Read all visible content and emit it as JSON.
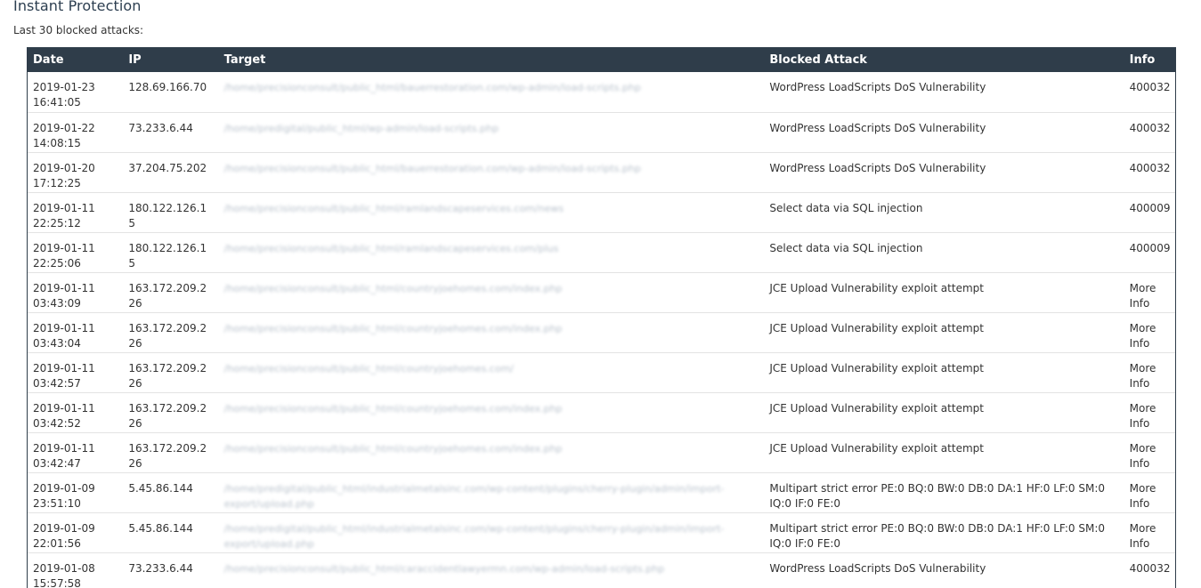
{
  "page": {
    "title": "Instant Protection",
    "subtitle": "Last 30 blocked attacks:"
  },
  "table": {
    "headers": {
      "date": "Date",
      "ip": "IP",
      "target": "Target",
      "attack": "Blocked Attack",
      "info": "Info"
    },
    "rows": [
      {
        "date": "2019-01-23",
        "time": "16:41:05",
        "ip": "128.69.166.70",
        "target": "/home/precisionconsult/public_html/bauerrestoration.com/wp-admin/load-scripts.php",
        "attack": "WordPress LoadScripts DoS Vulnerability",
        "info": "400032"
      },
      {
        "date": "2019-01-22",
        "time": "14:08:15",
        "ip": "73.233.6.44",
        "target": "/home/predigital/public_html/wp-admin/load-scripts.php",
        "attack": "WordPress LoadScripts DoS Vulnerability",
        "info": "400032"
      },
      {
        "date": "2019-01-20",
        "time": "17:12:25",
        "ip": "37.204.75.202",
        "target": "/home/precisionconsult/public_html/bauerrestoration.com/wp-admin/load-scripts.php",
        "attack": "WordPress LoadScripts DoS Vulnerability",
        "info": "400032"
      },
      {
        "date": "2019-01-11",
        "time": "22:25:12",
        "ip": "180.122.126.15",
        "target": "/home/precisionconsult/public_html/ramlandscapeservices.com/news",
        "attack": "Select data via SQL injection",
        "info": "400009"
      },
      {
        "date": "2019-01-11",
        "time": "22:25:06",
        "ip": "180.122.126.15",
        "target": "/home/precisionconsult/public_html/ramlandscapeservices.com/plus",
        "attack": "Select data via SQL injection",
        "info": "400009"
      },
      {
        "date": "2019-01-11",
        "time": "03:43:09",
        "ip": "163.172.209.226",
        "target": "/home/precisionconsult/public_html/countryjoehomes.com/index.php",
        "attack": "JCE Upload Vulnerability exploit attempt",
        "info": "More Info"
      },
      {
        "date": "2019-01-11",
        "time": "03:43:04",
        "ip": "163.172.209.226",
        "target": "/home/precisionconsult/public_html/countryjoehomes.com/index.php",
        "attack": "JCE Upload Vulnerability exploit attempt",
        "info": "More Info"
      },
      {
        "date": "2019-01-11",
        "time": "03:42:57",
        "ip": "163.172.209.226",
        "target": "/home/precisionconsult/public_html/countryjoehomes.com/",
        "attack": "JCE Upload Vulnerability exploit attempt",
        "info": "More Info"
      },
      {
        "date": "2019-01-11",
        "time": "03:42:52",
        "ip": "163.172.209.226",
        "target": "/home/precisionconsult/public_html/countryjoehomes.com/index.php",
        "attack": "JCE Upload Vulnerability exploit attempt",
        "info": "More Info"
      },
      {
        "date": "2019-01-11",
        "time": "03:42:47",
        "ip": "163.172.209.226",
        "target": "/home/precisionconsult/public_html/countryjoehomes.com/index.php",
        "attack": "JCE Upload Vulnerability exploit attempt",
        "info": "More Info"
      },
      {
        "date": "2019-01-09",
        "time": "23:51:10",
        "ip": "5.45.86.144",
        "target": "/home/predigital/public_html/industrialmetalsinc.com/wp-content/plugins/cherry-plugin/admin/import-export/upload.php",
        "attack": "Multipart strict error PE:0 BQ:0 BW:0 DB:0 DA:1 HF:0 LF:0 SM:0 IQ:0 IF:0 FE:0",
        "info": "More Info"
      },
      {
        "date": "2019-01-09",
        "time": "22:01:56",
        "ip": "5.45.86.144",
        "target": "/home/predigital/public_html/industrialmetalsinc.com/wp-content/plugins/cherry-plugin/admin/import-export/upload.php",
        "attack": "Multipart strict error PE:0 BQ:0 BW:0 DB:0 DA:1 HF:0 LF:0 SM:0 IQ:0 IF:0 FE:0",
        "info": "More Info"
      },
      {
        "date": "2019-01-08",
        "time": "15:57:58",
        "ip": "73.233.6.44",
        "target": "/home/precisionconsult/public_html/caraccidentlawyermn.com/wp-admin/load-scripts.php",
        "attack": "WordPress LoadScripts DoS Vulnerability",
        "info": "400032"
      }
    ]
  }
}
